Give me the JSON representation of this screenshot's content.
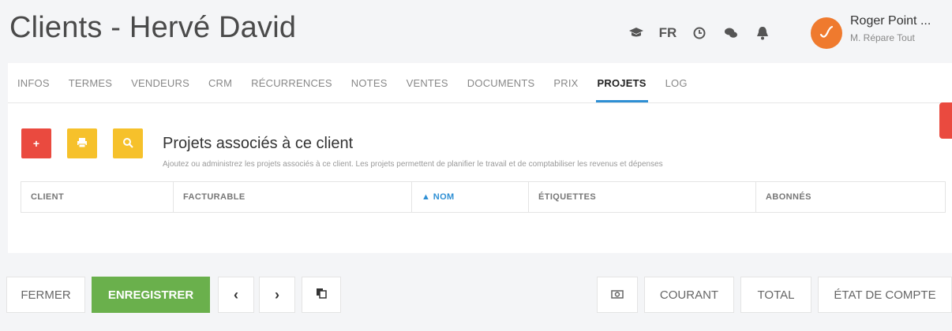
{
  "header": {
    "title": "Clients - Hervé David",
    "icons": [
      "graduation-cap-icon",
      "clock-icon",
      "chat-icon",
      "bell-icon"
    ],
    "language": "FR",
    "user_name": "Roger Point ...",
    "user_role": "M. Répare Tout"
  },
  "tabs": [
    "INFOS",
    "TERMES",
    "VENDEURS",
    "CRM",
    "RÉCURRENCES",
    "NOTES",
    "VENTES",
    "DOCUMENTS",
    "PRIX",
    "PROJETS",
    "LOG"
  ],
  "active_tab": "PROJETS",
  "section": {
    "title": "Projets associés à ce client",
    "subtitle": "Ajoutez ou administrez les projets associés à ce client. Les projets permettent de planifier le travail et de comptabiliser les revenus et dépenses",
    "buttons": {
      "add": "+",
      "print_icon": "printer-icon",
      "search_icon": "search-icon"
    }
  },
  "table": {
    "columns": [
      "CLIENT",
      "FACTURABLE",
      "▲ NOM",
      "ÉTIQUETTES",
      "ABONNÉS"
    ],
    "sorted_column": "NOM",
    "rows": []
  },
  "footer": {
    "close": "FERMER",
    "save": "ENREGISTRER",
    "prev": "‹",
    "next": "›",
    "copy_icon": "copy-icon",
    "camera_icon": "camera-icon",
    "current": "COURANT",
    "total": "TOTAL",
    "statement": "ÉTAT DE COMPTE"
  },
  "colors": {
    "accent": "#2e8fd4",
    "red": "#ea4a3f",
    "yellow": "#f6c12b",
    "green": "#6ab04c",
    "avatar": "#ef7a2e"
  }
}
